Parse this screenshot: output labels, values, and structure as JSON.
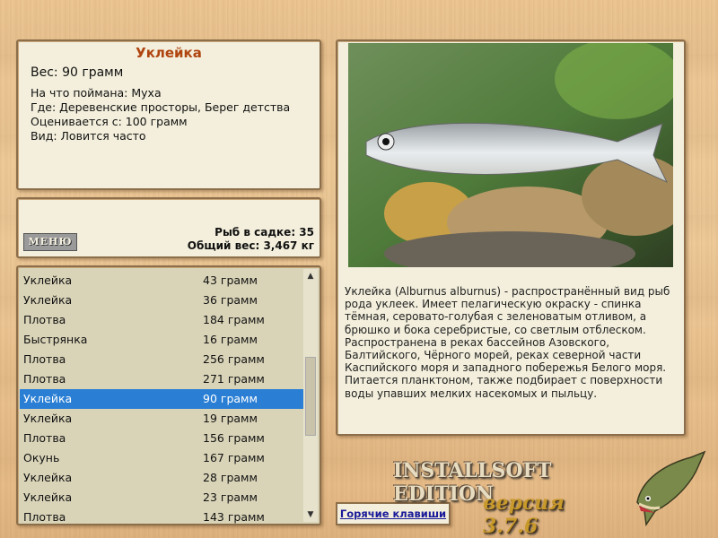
{
  "info": {
    "title": "Уклейка",
    "weight": "Вес: 90 грамм",
    "caught_on": "На что поймана: Муха",
    "where": "Где: Деревенские просторы, Берег детства",
    "valued": "Оценивается с: 100 грамм",
    "kind": "Вид: Ловится часто"
  },
  "stats": {
    "menu_label": "МЕНЮ",
    "fish_in_keepnet": "Рыб в садке: 35",
    "total_weight": "Общий вес: 3,467 кг"
  },
  "catch_list": {
    "rows": [
      {
        "name": "Уклейка",
        "weight": "43 грамм"
      },
      {
        "name": "Уклейка",
        "weight": "36 грамм"
      },
      {
        "name": "Плотва",
        "weight": "184 грамм"
      },
      {
        "name": "Быстрянка",
        "weight": "16 грамм"
      },
      {
        "name": "Плотва",
        "weight": "256 грамм"
      },
      {
        "name": "Плотва",
        "weight": "271 грамм"
      },
      {
        "name": "Уклейка",
        "weight": "90 грамм"
      },
      {
        "name": "Уклейка",
        "weight": "19 грамм"
      },
      {
        "name": "Плотва",
        "weight": "156 грамм"
      },
      {
        "name": "Окунь",
        "weight": "167 грамм"
      },
      {
        "name": "Уклейка",
        "weight": "28 грамм"
      },
      {
        "name": "Уклейка",
        "weight": "23 грамм"
      },
      {
        "name": "Плотва",
        "weight": "143 грамм"
      }
    ],
    "selected_index": 6
  },
  "description": "Уклейка (Alburnus alburnus) - распространённый вид рыб рода уклеек. Имеет пелагическую окраску - спинка тёмная, серовато-голубая с зеленоватым отливом, а брюшко и бока серебристые, со светлым отблеском. Распространена в реках бассейнов Азовского, Балтийского, Чёрного морей, реках северной части Каспийского моря и западного побережья Белого моря. Питается планктоном, также подбирает с поверхности воды упавших мелких насекомых и пыльцу.",
  "hotkeys_label": "Горячие клавиши",
  "brand": {
    "edition": "INSTALLSOFT EDITION",
    "version": "версия 3.7.6"
  },
  "icons": {
    "scroll_up": "▲",
    "scroll_down": "▼",
    "pike": "pike-fish-icon",
    "fish_photo": "bleak-fish-photo"
  },
  "colors": {
    "title": "#b0440f",
    "selected_row": "#2a7fd4",
    "panel_bg": "#f3efdc",
    "panel_border": "#8c6f4a",
    "link": "#1a1a9a"
  }
}
